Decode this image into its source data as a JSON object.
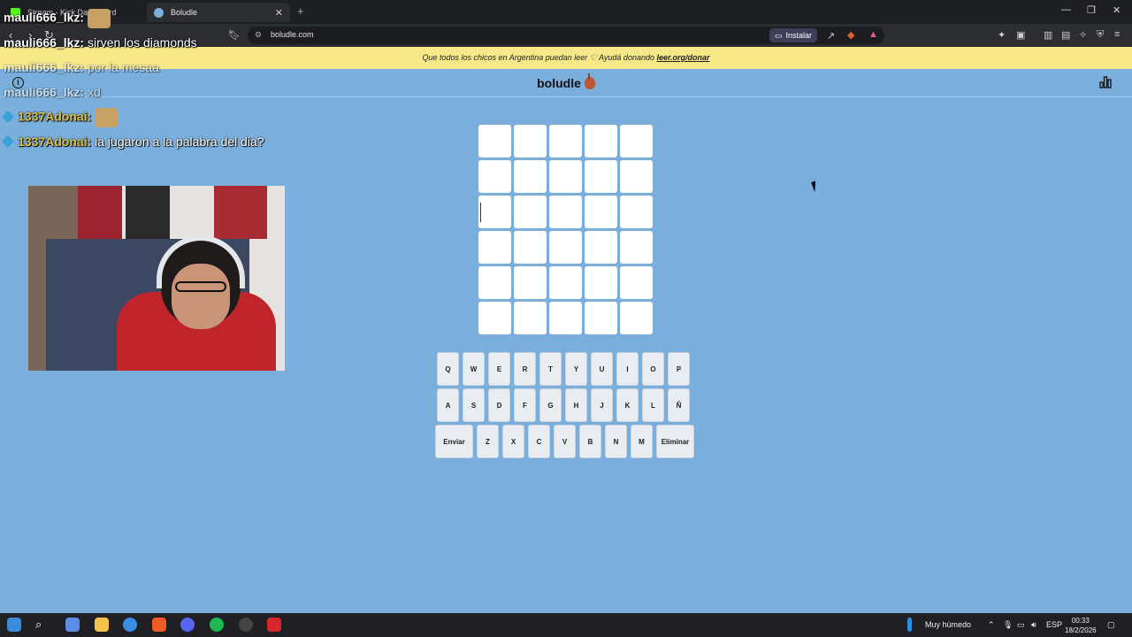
{
  "browser": {
    "tabs": [
      {
        "label": "Stream - Kick Dashboard",
        "active": false,
        "color": "#53fc18"
      },
      {
        "label": "Boludle",
        "active": true,
        "color": "#7aafdd"
      }
    ],
    "url": "boludle.com",
    "install_label": "Instalar"
  },
  "banner": {
    "text": "Que todos los chicos en Argentina puedan leer ♡ Ayudá donando",
    "link": "leer.org/donar"
  },
  "app": {
    "title": "boludle",
    "info_icon": "info-icon",
    "stats_icon": "bar-chart-icon"
  },
  "grid": {
    "rows": 6,
    "cols": 5,
    "cursor_row": 2,
    "cursor_col": 0
  },
  "keyboard": {
    "row1": [
      "Q",
      "W",
      "E",
      "R",
      "T",
      "Y",
      "U",
      "I",
      "O",
      "P"
    ],
    "row2": [
      "A",
      "S",
      "D",
      "F",
      "G",
      "H",
      "J",
      "K",
      "L",
      "Ñ"
    ],
    "row3": [
      "Enviar",
      "Z",
      "X",
      "C",
      "V",
      "B",
      "N",
      "M",
      "Eliminar"
    ]
  },
  "chat": [
    {
      "user": "mauli666_lkz:",
      "message": "",
      "faded": false,
      "gold": false,
      "badge": false,
      "emote": true
    },
    {
      "user": "mauli666_lkz:",
      "message": "sirven los diamonds",
      "faded": false,
      "gold": false,
      "badge": false,
      "emote": false
    },
    {
      "user": "mauli666_lkz:",
      "message": "por la mesaa",
      "faded": true,
      "gold": false,
      "badge": false,
      "emote": false
    },
    {
      "user": "mauli666_lkz:",
      "message": "xd",
      "faded": true,
      "gold": false,
      "badge": false,
      "emote": false
    },
    {
      "user": "1337Adonai:",
      "message": "",
      "faded": false,
      "gold": true,
      "badge": true,
      "emote": true
    },
    {
      "user": "1337Adonai:",
      "message": "ia jugaron a la palabra del dia?",
      "faded": false,
      "gold": true,
      "badge": true,
      "emote": false
    }
  ],
  "taskbar": {
    "weather": "Muy húmedo",
    "lang": "ESP",
    "time": "00:33",
    "date": "18/2/2026"
  }
}
